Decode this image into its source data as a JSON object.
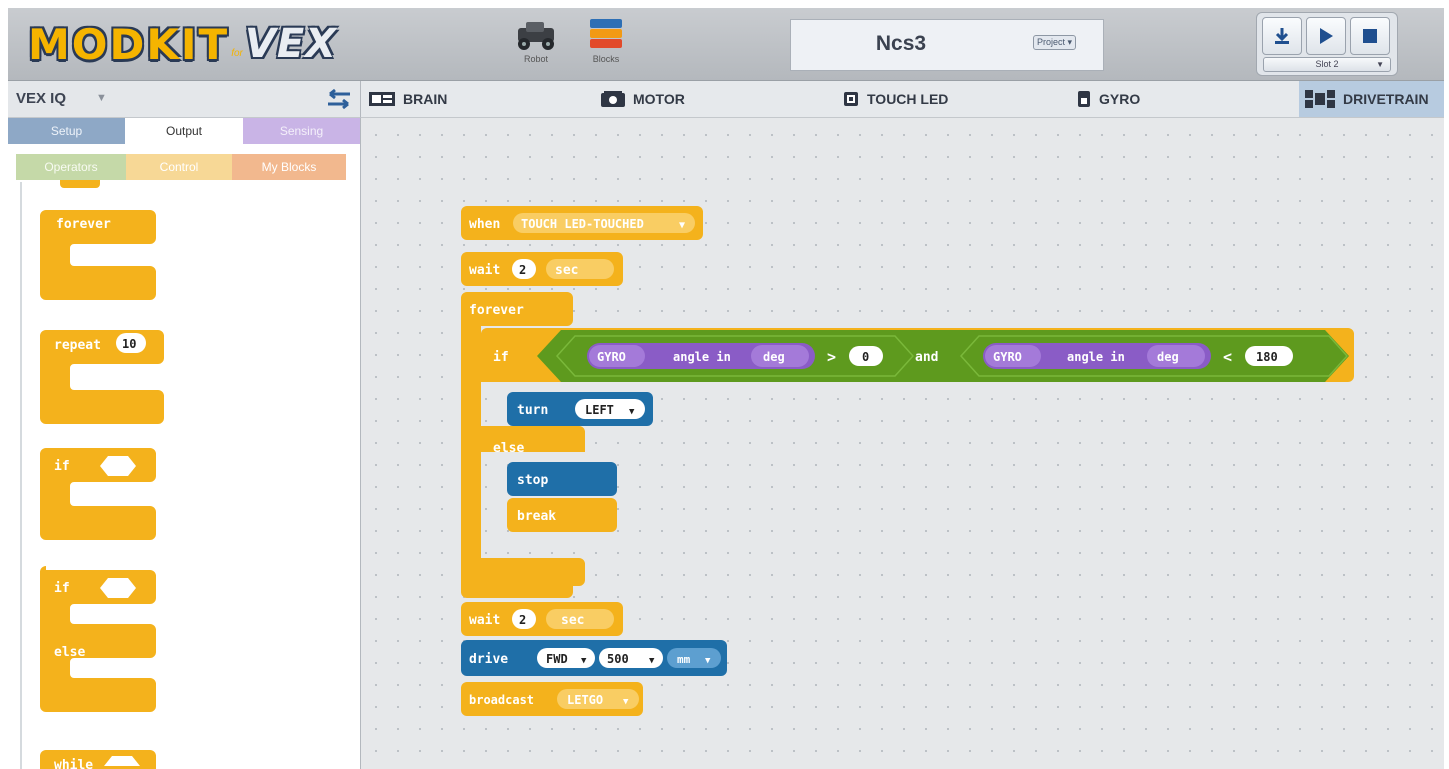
{
  "app": {
    "logo_main": "MODKIT",
    "logo_for": "for",
    "logo_vex": "VEX",
    "modes": {
      "robot_label": "Robot",
      "blocks_label": "Blocks"
    },
    "project": {
      "name": "Ncs3",
      "menu_label": "Project ▾"
    },
    "run": {
      "slot_label": "Slot 2"
    }
  },
  "sidebar": {
    "platform": "VEX IQ",
    "categories_top": [
      "Setup",
      "Output",
      "Sensing"
    ],
    "categories_sub": [
      "Operators",
      "Control",
      "My Blocks"
    ],
    "active_category": "Output",
    "palette": {
      "forever": "forever",
      "repeat": "repeat",
      "repeat_count": "10",
      "if": "if",
      "ifelse_if": "if",
      "ifelse_else": "else",
      "while": "while"
    }
  },
  "device_tabs": [
    "BRAIN",
    "MOTOR",
    "TOUCH LED",
    "GYRO",
    "DRIVETRAIN"
  ],
  "active_device_tab": "DRIVETRAIN",
  "script": {
    "when": {
      "label": "when",
      "event": "TOUCH LED-TOUCHED"
    },
    "wait1": {
      "label": "wait",
      "value": "2",
      "unit": "sec"
    },
    "forever": "forever",
    "if": {
      "label": "if",
      "left": {
        "device": "GYRO",
        "prop": "angle in",
        "unit": "deg",
        "op": ">",
        "value": "0"
      },
      "joiner": "and",
      "right": {
        "device": "GYRO",
        "prop": "angle in",
        "unit": "deg",
        "op": "<",
        "value": "180"
      }
    },
    "turn": {
      "label": "turn",
      "dir": "LEFT"
    },
    "else": "else",
    "stop": "stop",
    "break": "break",
    "wait2": {
      "label": "wait",
      "value": "2",
      "unit": "sec"
    },
    "drive": {
      "label": "drive",
      "dir": "FWD",
      "dist": "500",
      "unit": "mm"
    },
    "broadcast": {
      "label": "broadcast",
      "message": "LETGO"
    }
  },
  "colors": {
    "control": "#f4b21c",
    "motion": "#1f6fa8",
    "sensing": "#8a5cc6",
    "operator": "#5e9a1e",
    "event": "#f4b21c"
  }
}
